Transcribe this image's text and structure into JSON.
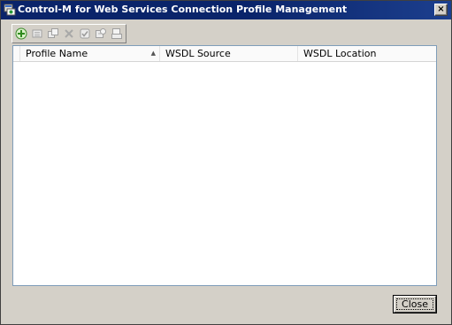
{
  "window": {
    "title": "Control-M for Web Services Connection Profile Management",
    "close_glyph": "×"
  },
  "toolbar": {
    "buttons": [
      {
        "icon": "add-icon",
        "enabled": true
      },
      {
        "icon": "edit-icon",
        "enabled": false
      },
      {
        "icon": "duplicate-icon",
        "enabled": false
      },
      {
        "icon": "delete-icon",
        "enabled": false
      },
      {
        "icon": "validate-icon",
        "enabled": false
      },
      {
        "icon": "refresh-icon",
        "enabled": false
      },
      {
        "icon": "export-icon",
        "enabled": false
      }
    ]
  },
  "table": {
    "columns": [
      "Profile Name",
      "WSDL Source",
      "WSDL Location"
    ],
    "sort_glyph": "▲",
    "rows": []
  },
  "footer": {
    "close_label": "Close"
  }
}
